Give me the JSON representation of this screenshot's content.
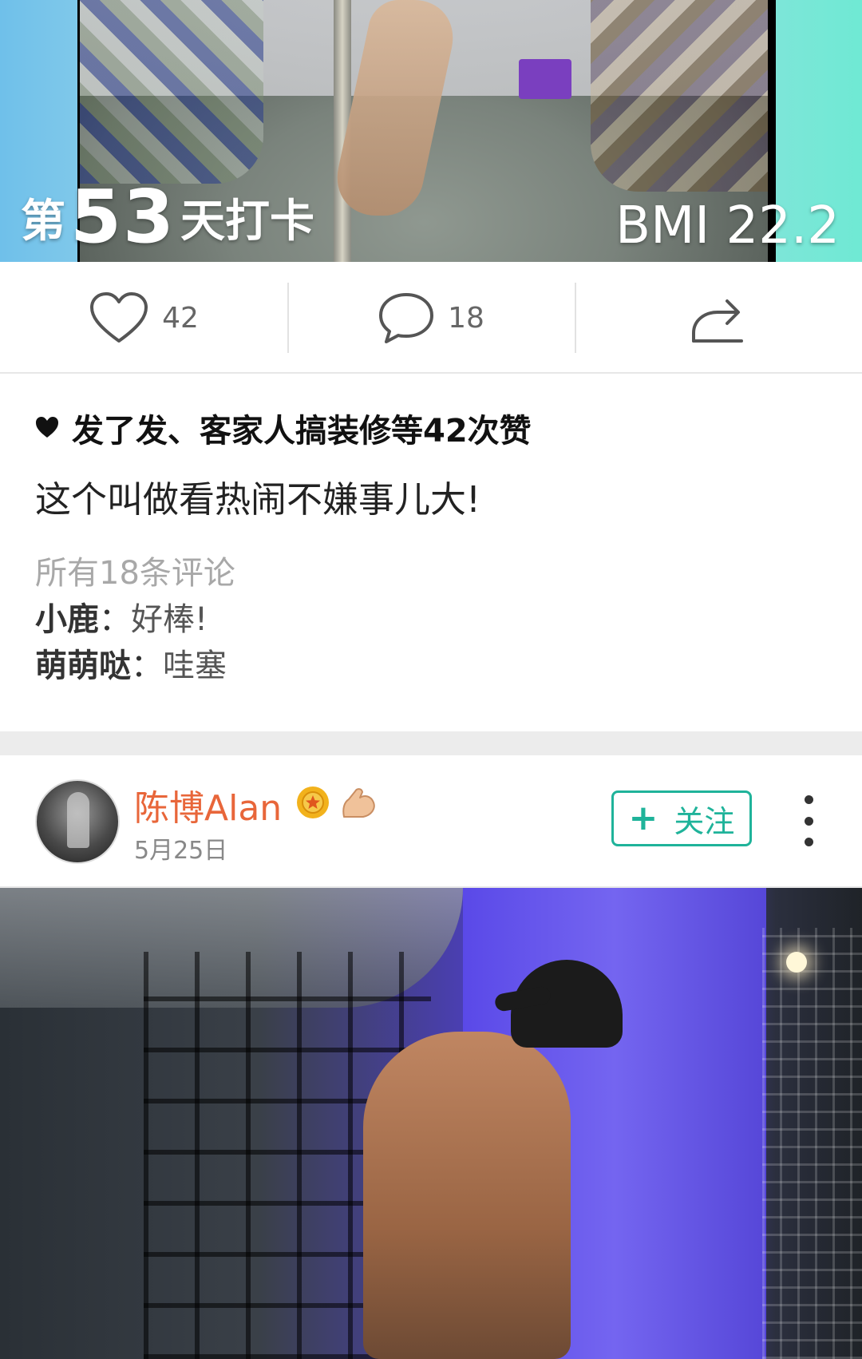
{
  "post1": {
    "checkin": {
      "prefix": "第",
      "day": "53",
      "suffix": "天打卡"
    },
    "bmi": "BMI 22.2",
    "actions": {
      "likes": "42",
      "comments": "18"
    },
    "liked_by": "发了发、客家人搞装修等42次赞",
    "caption": "这个叫做看热闹不嫌事儿大!",
    "all_comments_label": "所有18条评论",
    "comments": [
      {
        "author": "小鹿",
        "text": "好棒!"
      },
      {
        "author": "萌萌哒",
        "text": "哇塞"
      }
    ]
  },
  "post2": {
    "username": "陈博Alan",
    "date": "5月25日",
    "follow_label": "关注",
    "badges": [
      "medal-icon",
      "muscle-icon"
    ]
  },
  "colors": {
    "username": "#e8663a",
    "follow_accent": "#1fb39a",
    "separator": "#ececec"
  }
}
